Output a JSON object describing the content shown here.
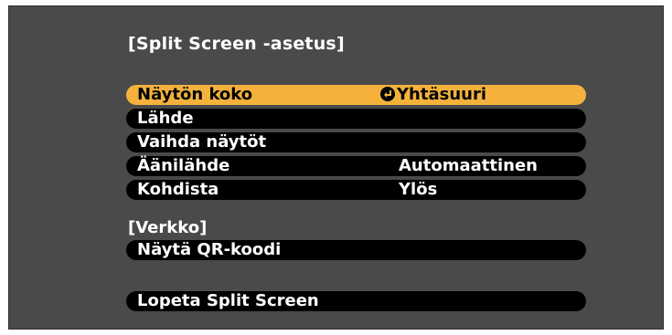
{
  "title": "[Split Screen -asetus]",
  "menu": [
    {
      "label": "Näytön koko",
      "value": "Yhtäsuuri",
      "selected": true
    },
    {
      "label": "Lähde",
      "value": ""
    },
    {
      "label": "Vaihda näytöt",
      "value": ""
    },
    {
      "label": "Äänilähde",
      "value": "Automaattinen"
    },
    {
      "label": "Kohdista",
      "value": "Ylös"
    }
  ],
  "network_section": "[Verkko]",
  "show_qr_label": "Näytä QR-koodi",
  "exit_label": "Lopeta Split Screen",
  "colors": {
    "selected": "#f4b23d",
    "row": "#000000",
    "background": "#4a4a4a"
  }
}
